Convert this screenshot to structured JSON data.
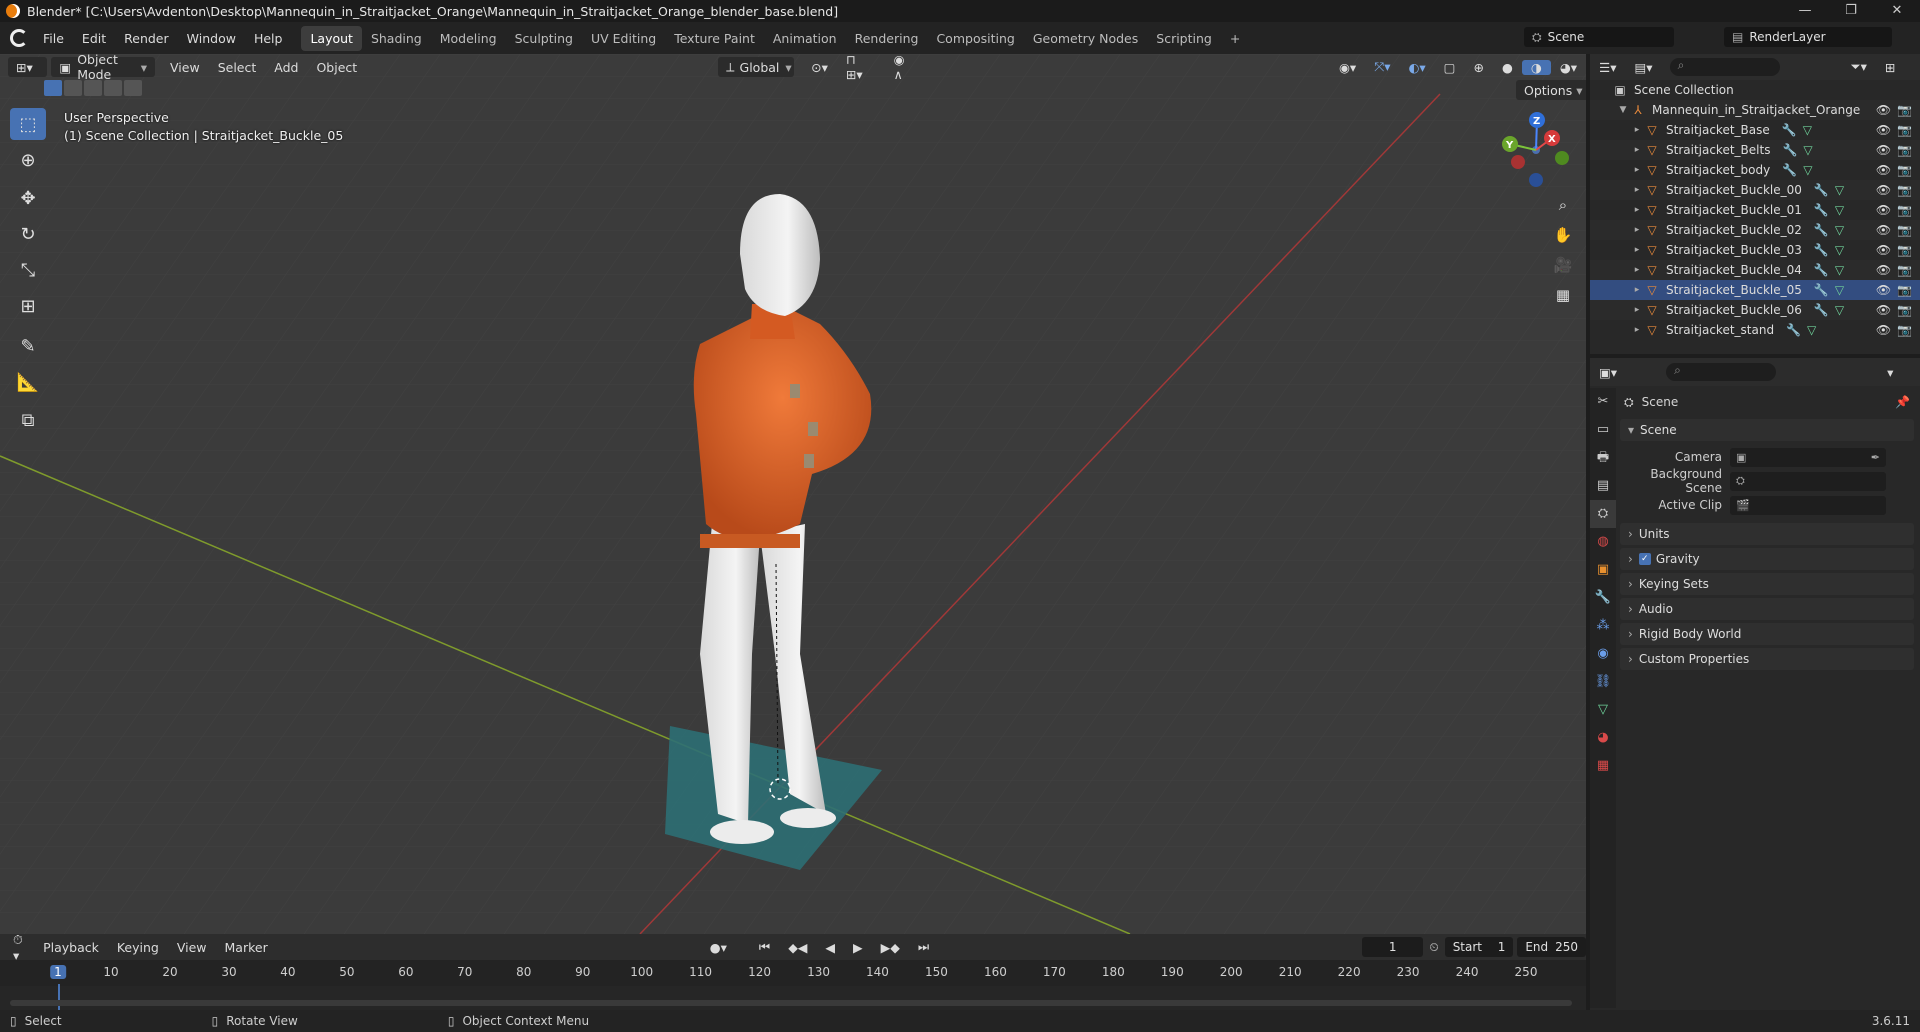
{
  "window": {
    "title": "Blender* [C:\\Users\\Avdenton\\Desktop\\Mannequin_in_Straitjacket_Orange\\Mannequin_in_Straitjacket_Orange_blender_base.blend]",
    "controls": [
      "—",
      "❐",
      "✕"
    ]
  },
  "menubar": {
    "items": [
      "File",
      "Edit",
      "Render",
      "Window",
      "Help"
    ],
    "workspaces": [
      "Layout",
      "Shading",
      "Modeling",
      "Sculpting",
      "UV Editing",
      "Texture Paint",
      "Animation",
      "Rendering",
      "Compositing",
      "Geometry Nodes",
      "Scripting"
    ],
    "active_workspace": "Layout",
    "add_tab": "+",
    "scene": "Scene",
    "view_layer": "RenderLayer"
  },
  "viewport": {
    "mode": "Object Mode",
    "menus": [
      "View",
      "Select",
      "Add",
      "Object"
    ],
    "orientation": "Global",
    "options_label": "Options",
    "overlay_line1": "User Perspective",
    "overlay_line2": "(1) Scene Collection | Straitjacket_Buckle_05",
    "gizmo_axes": [
      "X",
      "Y",
      "Z"
    ]
  },
  "outliner": {
    "root": "Scene Collection",
    "collection": "Mannequin_in_Straitjacket_Orange",
    "objects": [
      "Straitjacket_Base",
      "Straitjacket_Belts",
      "Straitjacket_body",
      "Straitjacket_Buckle_00",
      "Straitjacket_Buckle_01",
      "Straitjacket_Buckle_02",
      "Straitjacket_Buckle_03",
      "Straitjacket_Buckle_04",
      "Straitjacket_Buckle_05",
      "Straitjacket_Buckle_06",
      "Straitjacket_stand"
    ],
    "selected": "Straitjacket_Buckle_05"
  },
  "properties": {
    "context": "Scene",
    "section": "Scene",
    "fields": [
      {
        "label": "Camera",
        "value": ""
      },
      {
        "label": "Background Scene",
        "value": ""
      },
      {
        "label": "Active Clip",
        "value": ""
      }
    ],
    "panels": [
      "Units",
      "Gravity",
      "Keying Sets",
      "Audio",
      "Rigid Body World",
      "Custom Properties"
    ],
    "gravity_checked": true
  },
  "timeline": {
    "menus": [
      "Playback",
      "Keying",
      "View",
      "Marker"
    ],
    "current_frame": "1",
    "start_label": "Start",
    "start": "1",
    "end_label": "End",
    "end": "250",
    "ruler": [
      "1",
      "10",
      "20",
      "30",
      "40",
      "50",
      "60",
      "70",
      "80",
      "90",
      "100",
      "110",
      "120",
      "130",
      "140",
      "150",
      "160",
      "170",
      "180",
      "190",
      "200",
      "210",
      "220",
      "230",
      "240",
      "250"
    ]
  },
  "statusbar": {
    "select": "Select",
    "rotate": "Rotate View",
    "context_menu": "Object Context Menu",
    "version": "3.6.11"
  }
}
